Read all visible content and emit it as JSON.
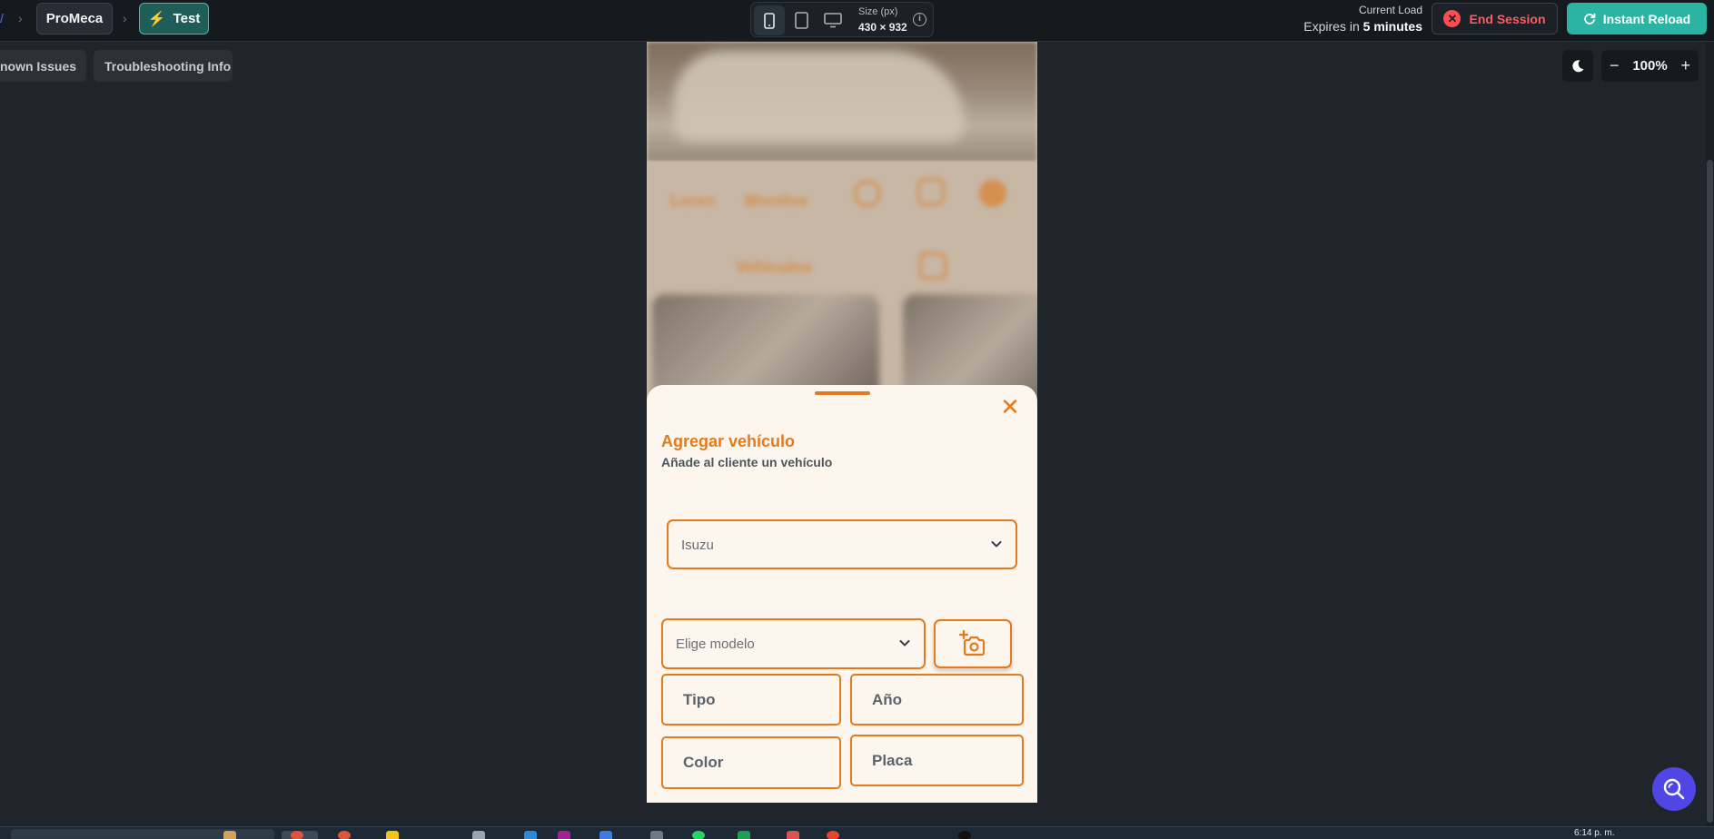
{
  "topbar": {
    "app_name": "ProMeca",
    "test_label": "Test",
    "size_label": "Size (px)",
    "size_value": "430 × 932",
    "load_label": "Current Load",
    "expires_prefix": "Expires in ",
    "expires_value": "5 minutes",
    "end_session_label": "End Session",
    "instant_reload_label": "Instant Reload"
  },
  "toolbar": {
    "known_issues_label": "nown Issues",
    "troubleshooting_label": "Troubleshooting Info",
    "zoom_level": "100%"
  },
  "sheet": {
    "title": "Agregar vehículo",
    "subtitle": "Añade al cliente un vehículo",
    "brand_value": "Isuzu",
    "model_placeholder": "Elige modelo",
    "fields": {
      "tipo": "Tipo",
      "anio": "Año",
      "color": "Color",
      "placa": "Placa"
    }
  },
  "taskbar": {
    "clock": "6:14 p. m."
  },
  "colors": {
    "accent_orange": "#e37a1b",
    "teal": "#2bb3a3",
    "danger": "#ff4d52",
    "help_purple": "#4f46e5"
  }
}
